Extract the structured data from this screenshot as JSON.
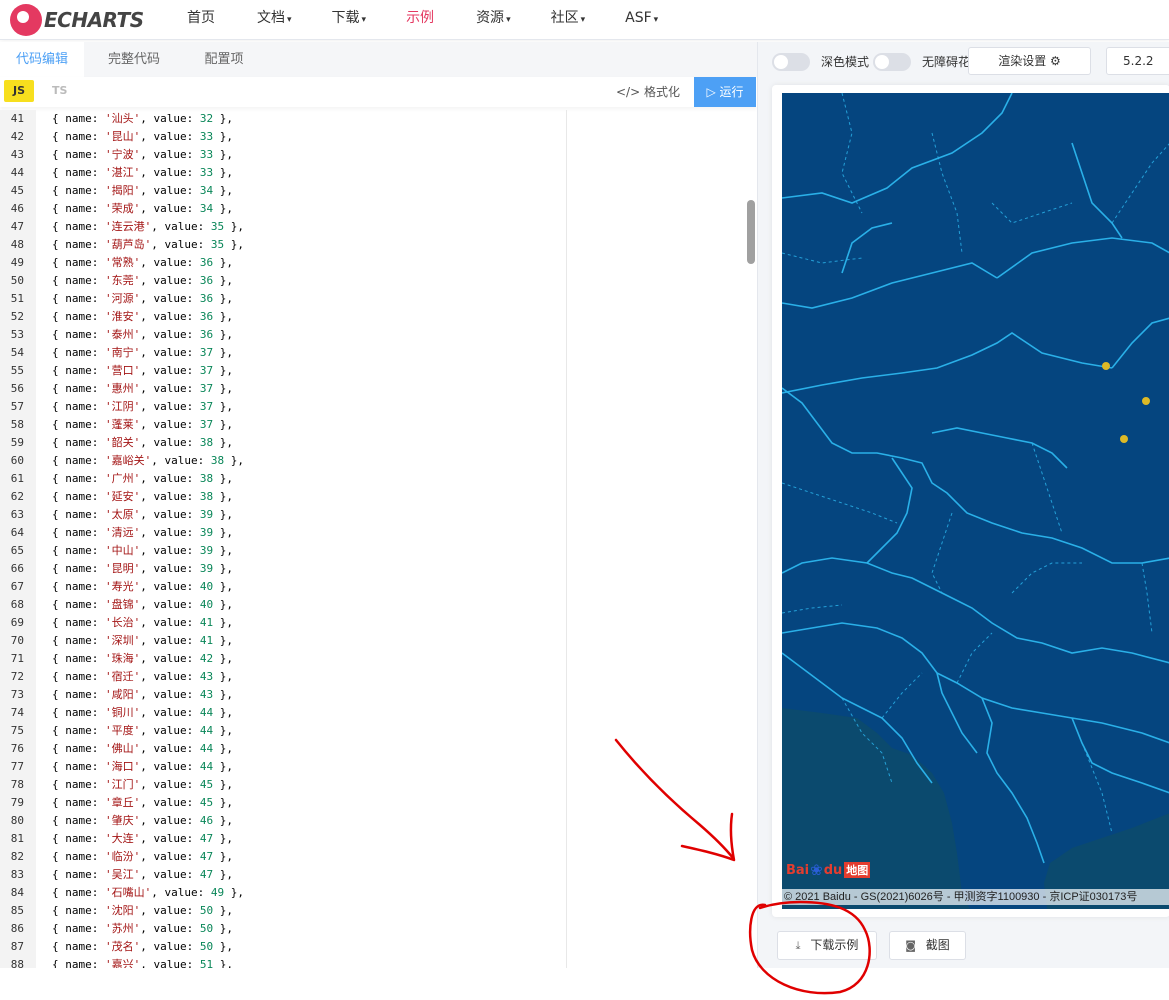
{
  "logo": {
    "text": "ECHARTS"
  },
  "nav": [
    {
      "label": "首页",
      "caret": ""
    },
    {
      "label": "文档",
      "caret": "▾"
    },
    {
      "label": "下载",
      "caret": "▾"
    },
    {
      "label": "示例",
      "caret": ""
    },
    {
      "label": "资源",
      "caret": "▾"
    },
    {
      "label": "社区",
      "caret": "▾"
    },
    {
      "label": "ASF",
      "caret": "▾"
    }
  ],
  "editor": {
    "tabs": [
      "代码编辑",
      "完整代码",
      "配置项"
    ],
    "lang_js": "JS",
    "lang_ts": "TS",
    "format_label": "格式化",
    "run_label": "运行",
    "lines": [
      {
        "n": 41,
        "name": "汕头",
        "value": 32
      },
      {
        "n": 42,
        "name": "昆山",
        "value": 33
      },
      {
        "n": 43,
        "name": "宁波",
        "value": 33
      },
      {
        "n": 44,
        "name": "湛江",
        "value": 33
      },
      {
        "n": 45,
        "name": "揭阳",
        "value": 34
      },
      {
        "n": 46,
        "name": "荣成",
        "value": 34
      },
      {
        "n": 47,
        "name": "连云港",
        "value": 35
      },
      {
        "n": 48,
        "name": "葫芦岛",
        "value": 35
      },
      {
        "n": 49,
        "name": "常熟",
        "value": 36
      },
      {
        "n": 50,
        "name": "东莞",
        "value": 36
      },
      {
        "n": 51,
        "name": "河源",
        "value": 36
      },
      {
        "n": 52,
        "name": "淮安",
        "value": 36
      },
      {
        "n": 53,
        "name": "泰州",
        "value": 36
      },
      {
        "n": 54,
        "name": "南宁",
        "value": 37
      },
      {
        "n": 55,
        "name": "营口",
        "value": 37
      },
      {
        "n": 56,
        "name": "惠州",
        "value": 37
      },
      {
        "n": 57,
        "name": "江阴",
        "value": 37
      },
      {
        "n": 58,
        "name": "蓬莱",
        "value": 37
      },
      {
        "n": 59,
        "name": "韶关",
        "value": 38
      },
      {
        "n": 60,
        "name": "嘉峪关",
        "value": 38
      },
      {
        "n": 61,
        "name": "广州",
        "value": 38
      },
      {
        "n": 62,
        "name": "延安",
        "value": 38
      },
      {
        "n": 63,
        "name": "太原",
        "value": 39
      },
      {
        "n": 64,
        "name": "清远",
        "value": 39
      },
      {
        "n": 65,
        "name": "中山",
        "value": 39
      },
      {
        "n": 66,
        "name": "昆明",
        "value": 39
      },
      {
        "n": 67,
        "name": "寿光",
        "value": 40
      },
      {
        "n": 68,
        "name": "盘锦",
        "value": 40
      },
      {
        "n": 69,
        "name": "长治",
        "value": 41
      },
      {
        "n": 70,
        "name": "深圳",
        "value": 41
      },
      {
        "n": 71,
        "name": "珠海",
        "value": 42
      },
      {
        "n": 72,
        "name": "宿迁",
        "value": 43
      },
      {
        "n": 73,
        "name": "咸阳",
        "value": 43
      },
      {
        "n": 74,
        "name": "铜川",
        "value": 44
      },
      {
        "n": 75,
        "name": "平度",
        "value": 44
      },
      {
        "n": 76,
        "name": "佛山",
        "value": 44
      },
      {
        "n": 77,
        "name": "海口",
        "value": 44
      },
      {
        "n": 78,
        "name": "江门",
        "value": 45
      },
      {
        "n": 79,
        "name": "章丘",
        "value": 45
      },
      {
        "n": 80,
        "name": "肇庆",
        "value": 46
      },
      {
        "n": 81,
        "name": "大连",
        "value": 47
      },
      {
        "n": 82,
        "name": "临汾",
        "value": 47
      },
      {
        "n": 83,
        "name": "吴江",
        "value": 47
      },
      {
        "n": 84,
        "name": "石嘴山",
        "value": 49
      },
      {
        "n": 85,
        "name": "沈阳",
        "value": 50
      },
      {
        "n": 86,
        "name": "苏州",
        "value": 50
      },
      {
        "n": 87,
        "name": "茂名",
        "value": 50
      },
      {
        "n": 88,
        "name": "嘉兴",
        "value": 51
      }
    ]
  },
  "preview": {
    "dark_mode_label": "深色模式",
    "accessible_label": "无障碍花纹",
    "render_settings_label": "渲染设置",
    "version": "5.2.2",
    "baidu_logo_text": "Bai",
    "baidu_logo_du": "du",
    "baidu_logo_map": "地图",
    "copyright": "© 2021 Baidu - GS(2021)6026号 - 甲测资字1100930 - 京ICP证030173号",
    "download_label": "下载示例",
    "screenshot_label": "截图"
  },
  "colors": {
    "brand": "#e43961",
    "accent": "#4da0f5",
    "map_bg": "#05457f",
    "border_line": "#2ab0e8",
    "scatter": "#ddb926",
    "annotation": "#e00000"
  }
}
